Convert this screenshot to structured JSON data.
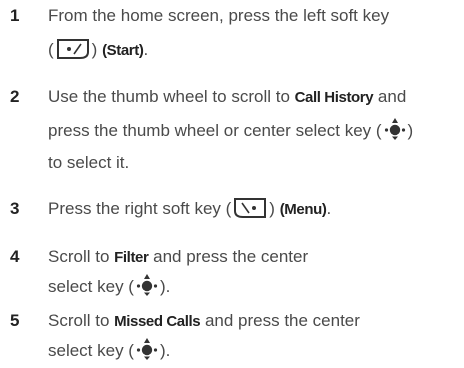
{
  "steps": [
    {
      "number": "1",
      "line1": "From the home screen, press the left soft key",
      "l2_open": "(",
      "l2_mid": ") ",
      "l2_bold": "(Start)",
      "l2_end": "."
    },
    {
      "number": "2",
      "l1_pre": "Use the thumb wheel to scroll to ",
      "l1_bold": "Call History",
      "l1_post": " and",
      "line2": "press the thumb wheel or center select key (",
      "line2_end": ")",
      "line3": "to select it."
    },
    {
      "number": "3",
      "pre": "Press the right soft key (",
      "mid": ") ",
      "bold": "(Menu)",
      "end": "."
    },
    {
      "number": "4",
      "l1_pre": "Scroll to ",
      "l1_bold": "Filter",
      "l1_post": " and press the center",
      "l2_pre": "select key (",
      "l2_end": ")."
    },
    {
      "number": "5",
      "l1_pre": "Scroll to ",
      "l1_bold": "Missed Calls",
      "l1_post": " and press the center",
      "l2_pre": "select key (",
      "l2_end": ")."
    }
  ],
  "icons": {
    "left_soft_key": "left-soft-key-icon",
    "right_soft_key": "right-soft-key-icon",
    "center_select_key": "center-select-key-icon"
  }
}
